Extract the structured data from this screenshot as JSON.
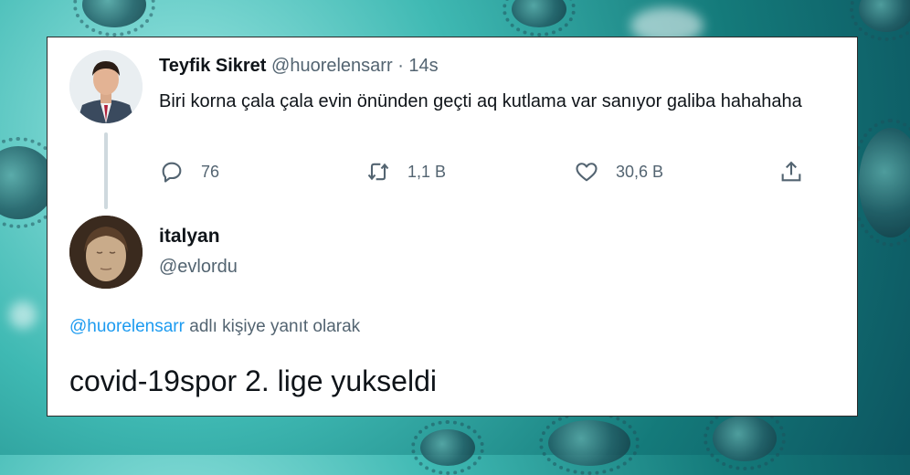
{
  "tweet": {
    "author_name": "Teyfik Sikret",
    "author_handle": "@huorelensarr",
    "separator": "·",
    "time": "14s",
    "text": "Biri korna çala çala evin önünden geçti aq kutlama var sanıyor galiba hahahaha",
    "actions": {
      "reply_icon": "reply-icon",
      "reply_count": "76",
      "retweet_icon": "retweet-icon",
      "retweet_count": "1,1 B",
      "like_icon": "heart-icon",
      "like_count": "30,6 B",
      "share_icon": "share-icon"
    }
  },
  "reply": {
    "author_name": "italyan",
    "author_handle": "@evlordu",
    "replying_to_handle": "@huorelensarr",
    "replying_to_suffix": " adlı kişiye yanıt olarak",
    "text": "covid-19spor 2. lige yukseldi"
  },
  "colors": {
    "link": "#1d9bf0",
    "secondary_text": "#536471",
    "primary_text": "#0f1419"
  }
}
